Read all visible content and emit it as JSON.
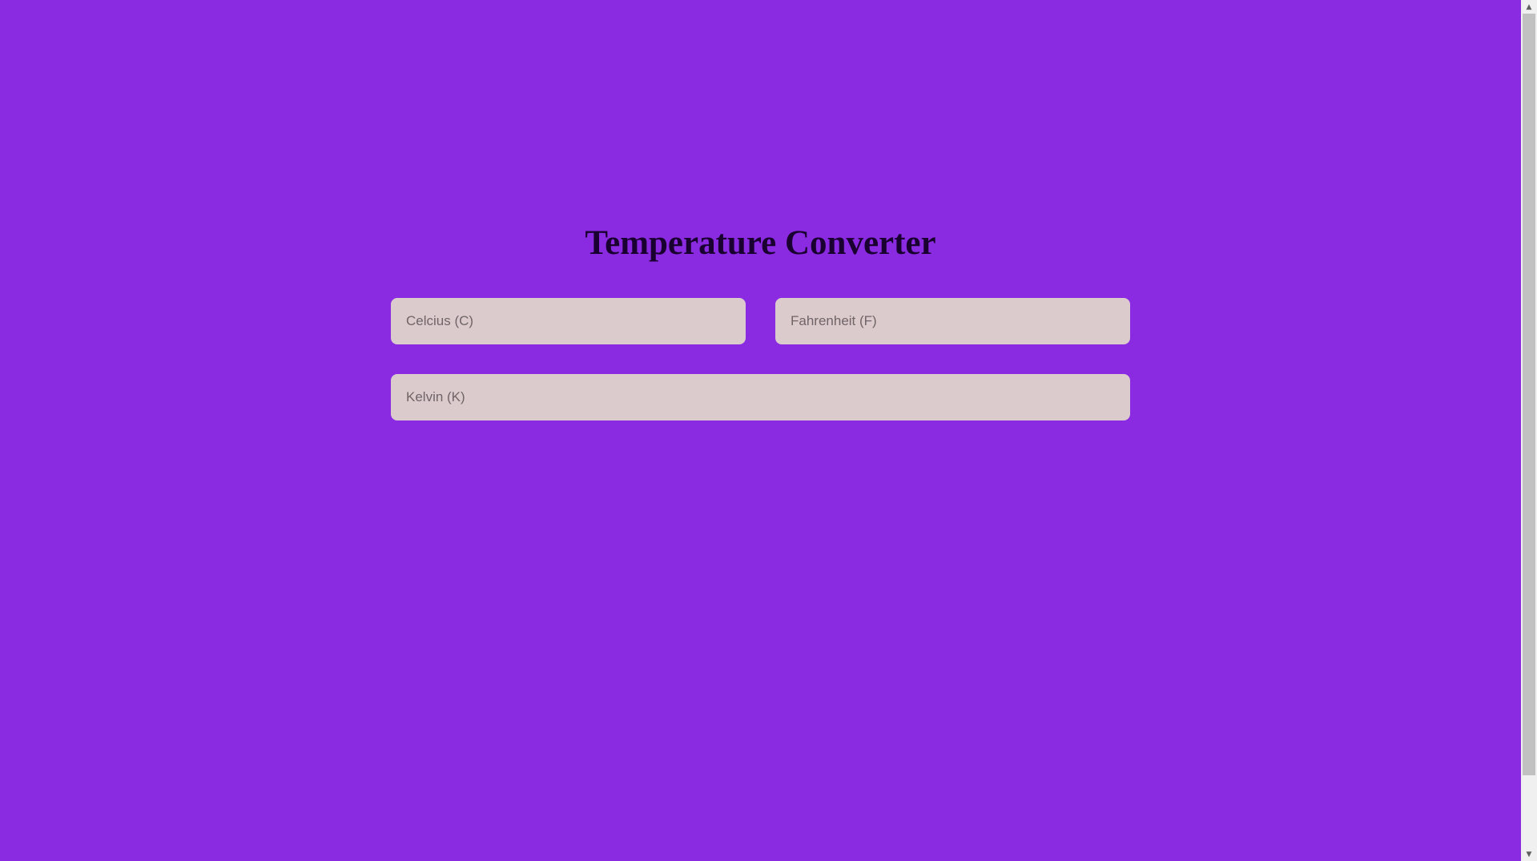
{
  "page": {
    "title": "Temperature Converter",
    "background_color": "#8a2be2"
  },
  "fields": {
    "celsius": {
      "placeholder": "Celcius (C)",
      "value": ""
    },
    "fahrenheit": {
      "placeholder": "Fahrenheit (F)",
      "value": ""
    },
    "kelvin": {
      "placeholder": "Kelvin (K)",
      "value": ""
    }
  },
  "scrollbar": {
    "up_icon": "chevron-up-icon",
    "down_icon": "chevron-down-icon"
  }
}
